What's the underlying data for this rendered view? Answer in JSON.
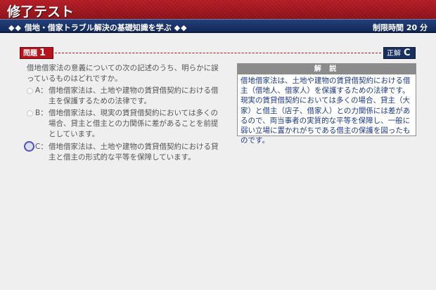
{
  "header": {
    "title_prefix": "修了",
    "title_suffix": "テスト",
    "course_diamonds_left": "◆◆",
    "course_name": "借地・借家トラブル解決の基礎知識を学ぶ",
    "course_diamonds_right": "◆◆",
    "time_limit": "制限時間 20 分"
  },
  "question": {
    "label": "問題",
    "number": "1",
    "text": "借地借家法の意義についての次の記述のうち、明らかに誤っているものはどれですか。",
    "choices": [
      {
        "letter": "A：",
        "text": "借地借家法は、土地や建物の賃貸借契約における借主を保護するための法律です。"
      },
      {
        "letter": "B：",
        "text": "借地借家法は、現実の賃貸借契約においては多くの場合、貸主と借主との力関係に差があることを前提としています。"
      },
      {
        "letter": "C：",
        "text": "借地借家法は、土地や建物の賃貸借契約における貸主と借主の形式的な平等を保障しています。"
      }
    ],
    "selected": "C"
  },
  "answer": {
    "label": "正解",
    "value": "C"
  },
  "explanation": {
    "heading": "解 説",
    "text": "借地借家法は、土地や建物の賃貸借契約における借主（借地人、借家人）を保護するための法律です。現実の賃貸借契約においては多くの場合、貸主（大家）と借主（店子、借家人）との力関係には差があるので、両当事者の実質的な平等を保障し、一般に弱い立場に置かれがちである借主の保護を図ったものです。"
  },
  "colors": {
    "header_red": "#a0161e",
    "subbar_navy": "#1b3468",
    "explanation_text": "#1c3a8c",
    "selected_radio": "#4b53c4"
  }
}
